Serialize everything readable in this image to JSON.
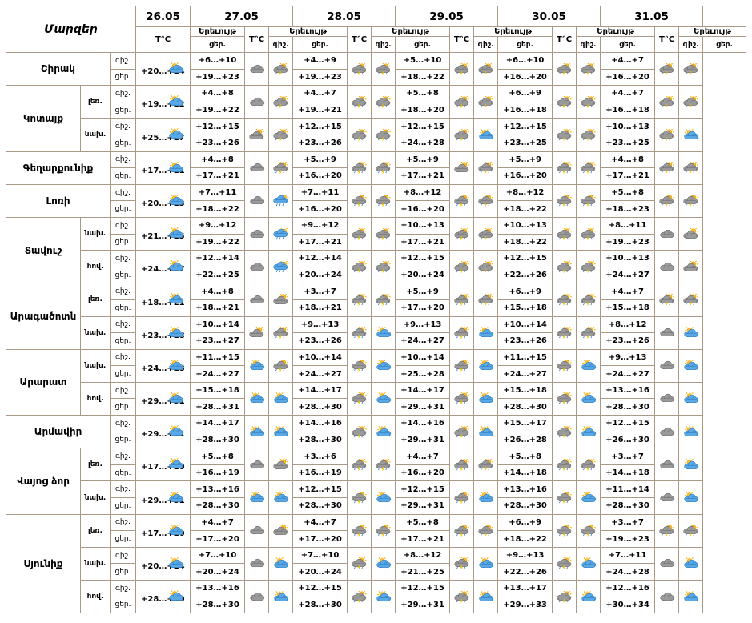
{
  "header": {
    "title": "Մարզեր",
    "dates": [
      "26.05",
      "27.05",
      "28.05",
      "29.05",
      "30.05",
      "31.05"
    ],
    "temp_label": "T°C",
    "phen_label": "Երեւույթ",
    "night_label": "գիշ.",
    "day_label": "ցեր."
  },
  "rows": [
    {
      "region": "Շիրակ",
      "zone": "",
      "tod": "գիշ.",
      "first": "",
      "vals": [
        "+6…+10",
        "+4…+9",
        "+5…+10",
        "+6…+10",
        "+4…+7"
      ],
      "icons": [
        "cloud",
        "storm-sun",
        "storm-sun",
        "storm-sun",
        "storm-sun",
        "storm-sun",
        "storm-sun",
        "storm-sun",
        "storm-sun",
        "storm-sun"
      ]
    },
    {
      "region": "",
      "zone": "",
      "tod": "ցեր.",
      "first": "+20…+24",
      "vals": [
        "+19…+23",
        "+19…+23",
        "+18…+22",
        "+16…+20",
        "+16…+20"
      ],
      "first_icon": "sun-cloud"
    },
    {
      "region": "Կոտայք",
      "zone": "լեռ.",
      "tod": "գիշ.",
      "first": "",
      "vals": [
        "+4…+8",
        "+4…+7",
        "+5…+8",
        "+6…+9",
        "+4…+7"
      ],
      "icons": [
        "cloud",
        "storm-sun",
        "storm-sun",
        "storm-sun",
        "storm-sun",
        "storm-sun",
        "storm-sun",
        "storm-sun",
        "storm-sun",
        "storm-sun"
      ]
    },
    {
      "region": "",
      "zone": "",
      "tod": "ցեր.",
      "first": "+19…+22",
      "vals": [
        "+19…+22",
        "+19…+21",
        "+18…+20",
        "+16…+18",
        "+16…+18"
      ],
      "first_icon": "sun-cloud"
    },
    {
      "region": "",
      "zone": "նախ.",
      "tod": "գիշ.",
      "first": "",
      "vals": [
        "+12…+15",
        "+12…+15",
        "+12…+15",
        "+12…+15",
        "+10…+13"
      ],
      "icons": [
        "cloud-sun",
        "storm-sun",
        "storm-sun",
        "storm-sun",
        "storm-sun",
        "sun-cloud",
        "storm-sun",
        "storm-sun",
        "storm-sun",
        "sun-cloud"
      ]
    },
    {
      "region": "",
      "zone": "",
      "tod": "ցեր.",
      "first": "+25…+27",
      "vals": [
        "+23…+26",
        "+23…+26",
        "+24…+28",
        "+23…+25",
        "+23…+25"
      ],
      "first_icon": "sun-cloud"
    },
    {
      "region": "Գեղարքունիք",
      "zone": "",
      "tod": "գիշ.",
      "first": "",
      "vals": [
        "+4…+8",
        "+5…+9",
        "+5…+9",
        "+5…+9",
        "+4…+8"
      ],
      "icons": [
        "cloud",
        "storm-sun",
        "storm-sun",
        "storm-sun",
        "cloud-sun",
        "storm-sun",
        "storm-sun",
        "storm-sun",
        "storm-sun",
        "storm-sun"
      ]
    },
    {
      "region": "",
      "zone": "",
      "tod": "ցեր.",
      "first": "+17…+21",
      "vals": [
        "+17…+21",
        "+16…+20",
        "+17…+21",
        "+16…+20",
        "+17…+21"
      ],
      "first_icon": "sun-cloud"
    },
    {
      "region": "Լոռի",
      "zone": "",
      "tod": "գիշ.",
      "first": "",
      "vals": [
        "+7…+11",
        "+7…+11",
        "+8…+12",
        "+8…+12",
        "+5…+8"
      ],
      "icons": [
        "cloud",
        "rain",
        "storm-sun",
        "storm-sun",
        "storm-sun",
        "storm-sun",
        "storm-sun",
        "storm-sun",
        "storm-sun",
        "storm-sun"
      ]
    },
    {
      "region": "",
      "zone": "",
      "tod": "ցեր.",
      "first": "+20…+23",
      "vals": [
        "+18…+22",
        "+16…+20",
        "+16…+20",
        "+18…+22",
        "+18…+23"
      ],
      "first_icon": "sun-cloud"
    },
    {
      "region": "Տավուշ",
      "zone": "նախ.",
      "tod": "գիշ.",
      "first": "",
      "vals": [
        "+9…+12",
        "+9…+12",
        "+10…+13",
        "+10…+13",
        "+8…+11"
      ],
      "icons": [
        "cloud",
        "rain",
        "storm-sun",
        "storm-sun",
        "storm-sun",
        "storm-sun",
        "storm-sun",
        "storm-sun",
        "cloud",
        "cloud-sun"
      ]
    },
    {
      "region": "",
      "zone": "",
      "tod": "ցեր.",
      "first": "+21…+25",
      "vals": [
        "+19…+22",
        "+17…+21",
        "+17…+21",
        "+18…+22",
        "+19…+23"
      ],
      "first_icon": "sun-cloud"
    },
    {
      "region": "",
      "zone": "հով.",
      "tod": "գիշ.",
      "first": "",
      "vals": [
        "+12…+14",
        "+12…+14",
        "+12…+15",
        "+12…+15",
        "+10…+13"
      ],
      "icons": [
        "cloud",
        "rain",
        "storm-sun",
        "storm-sun",
        "storm-sun",
        "storm-sun",
        "storm-sun",
        "storm-sun",
        "cloud",
        "cloud-sun"
      ]
    },
    {
      "region": "",
      "zone": "",
      "tod": "ցեր.",
      "first": "+24…+27",
      "vals": [
        "+22…+25",
        "+20…+24",
        "+20…+24",
        "+22…+26",
        "+24…+27"
      ],
      "first_icon": "sun-cloud"
    },
    {
      "region": "Արագածոտն",
      "zone": "լեռ.",
      "tod": "գիշ.",
      "first": "",
      "vals": [
        "+4…+8",
        "+3…+7",
        "+5…+9",
        "+6…+9",
        "+4…+7"
      ],
      "icons": [
        "cloud",
        "cloud-sun",
        "storm-sun",
        "storm-sun",
        "storm-sun",
        "storm-sun",
        "storm-sun",
        "storm-sun",
        "storm-sun",
        "storm-sun"
      ]
    },
    {
      "region": "",
      "zone": "",
      "tod": "ցեր.",
      "first": "+18…+21",
      "vals": [
        "+18…+21",
        "+18…+21",
        "+17…+20",
        "+15…+18",
        "+15…+18"
      ],
      "first_icon": "sun-cloud"
    },
    {
      "region": "",
      "zone": "նախ.",
      "tod": "գիշ.",
      "first": "",
      "vals": [
        "+10…+14",
        "+9…+13",
        "+9…+13",
        "+10…+14",
        "+8…+12"
      ],
      "icons": [
        "cloud-sun",
        "storm-sun",
        "storm-sun",
        "sun-cloud",
        "storm-sun",
        "sun-cloud",
        "storm-sun",
        "storm-sun",
        "cloud",
        "sun-cloud"
      ]
    },
    {
      "region": "",
      "zone": "",
      "tod": "ցեր.",
      "first": "+23…+28",
      "vals": [
        "+23…+27",
        "+23…+26",
        "+24…+27",
        "+23…+26",
        "+23…+26"
      ],
      "first_icon": "sun-cloud"
    },
    {
      "region": "Արարատ",
      "zone": "նախ.",
      "tod": "գիշ.",
      "first": "",
      "vals": [
        "+11…+15",
        "+10…+14",
        "+10…+14",
        "+11…+15",
        "+9…+13"
      ],
      "icons": [
        "sun-cloud",
        "storm-sun",
        "storm-sun",
        "sun-cloud",
        "storm-sun",
        "sun-cloud",
        "storm-sun",
        "sun-cloud",
        "cloud",
        "sun-cloud"
      ]
    },
    {
      "region": "",
      "zone": "",
      "tod": "ցեր.",
      "first": "+24…+28",
      "vals": [
        "+24…+27",
        "+24…+27",
        "+25…+28",
        "+24…+27",
        "+24…+27"
      ],
      "first_icon": "sun-cloud"
    },
    {
      "region": "",
      "zone": "հով.",
      "tod": "գիշ.",
      "first": "",
      "vals": [
        "+15…+18",
        "+14…+17",
        "+14…+17",
        "+15…+18",
        "+13…+16"
      ],
      "icons": [
        "sun-cloud",
        "sun-cloud",
        "storm-sun",
        "sun-cloud",
        "storm-sun",
        "sun-cloud",
        "storm-sun",
        "sun-cloud",
        "cloud",
        "sun-cloud"
      ]
    },
    {
      "region": "",
      "zone": "",
      "tod": "ցեր.",
      "first": "+29…+31",
      "vals": [
        "+28…+31",
        "+28…+30",
        "+29…+31",
        "+28…+30",
        "+28…+30"
      ],
      "first_icon": "sun-cloud"
    },
    {
      "region": "Արմավիր",
      "zone": "",
      "tod": "գիշ.",
      "first": "",
      "vals": [
        "+14…+17",
        "+14…+16",
        "+14…+16",
        "+15…+17",
        "+12…+15"
      ],
      "icons": [
        "sun-cloud",
        "sun-cloud",
        "storm-sun",
        "sun-cloud",
        "storm-sun",
        "sun-cloud",
        "storm-sun",
        "sun-cloud",
        "cloud",
        "sun-cloud"
      ]
    },
    {
      "region": "",
      "zone": "",
      "tod": "ցեր.",
      "first": "+29…+31",
      "vals": [
        "+28…+30",
        "+28…+30",
        "+29…+31",
        "+26…+28",
        "+26…+30"
      ],
      "first_icon": "sun-cloud"
    },
    {
      "region": "Վայոց ձոր",
      "zone": "լեռ.",
      "tod": "գիշ.",
      "first": "",
      "vals": [
        "+5…+8",
        "+3…+6",
        "+4…+7",
        "+5…+8",
        "+3…+7"
      ],
      "icons": [
        "cloud",
        "cloud-sun",
        "storm-sun",
        "storm-sun",
        "storm-sun",
        "storm-sun",
        "storm-sun",
        "storm-sun",
        "cloud",
        "sun-cloud"
      ]
    },
    {
      "region": "",
      "zone": "",
      "tod": "ցեր.",
      "first": "+17…+20",
      "vals": [
        "+16…+19",
        "+16…+19",
        "+16…+20",
        "+14…+18",
        "+14…+18"
      ],
      "first_icon": "sun-cloud"
    },
    {
      "region": "",
      "zone": "նախ.",
      "tod": "գիշ.",
      "first": "",
      "vals": [
        "+13…+16",
        "+12…+15",
        "+12…+15",
        "+13…+16",
        "+11…+14"
      ],
      "icons": [
        "sun-cloud",
        "sun-cloud",
        "storm-sun",
        "sun-cloud",
        "storm-sun",
        "sun-cloud",
        "storm-sun",
        "sun-cloud",
        "cloud",
        "sun-cloud"
      ]
    },
    {
      "region": "",
      "zone": "",
      "tod": "ցեր.",
      "first": "+29…+31",
      "vals": [
        "+28…+30",
        "+28…+30",
        "+29…+31",
        "+28…+30",
        "+28…+30"
      ],
      "first_icon": "sun-cloud"
    },
    {
      "region": "Սյունիք",
      "zone": "լեռ.",
      "tod": "գիշ.",
      "first": "",
      "vals": [
        "+4…+7",
        "+4…+7",
        "+5…+8",
        "+6…+9",
        "+3…+7"
      ],
      "icons": [
        "cloud",
        "cloud-sun",
        "storm-sun",
        "storm-sun",
        "storm-sun",
        "storm-sun",
        "storm-sun",
        "storm-sun",
        "storm-sun",
        "storm-sun"
      ]
    },
    {
      "region": "",
      "zone": "",
      "tod": "ցեր.",
      "first": "+17…+20",
      "vals": [
        "+17…+20",
        "+17…+20",
        "+17…+21",
        "+18…+22",
        "+19…+23"
      ],
      "first_icon": "sun-cloud"
    },
    {
      "region": "",
      "zone": "նախ.",
      "tod": "գիշ.",
      "first": "",
      "vals": [
        "+7…+10",
        "+7…+10",
        "+8…+12",
        "+9…+13",
        "+7…+11"
      ],
      "icons": [
        "cloud",
        "sun-cloud",
        "storm-sun",
        "sun-cloud",
        "storm-sun",
        "sun-cloud",
        "storm-sun",
        "sun-cloud",
        "cloud",
        "sun-cloud"
      ]
    },
    {
      "region": "",
      "zone": "",
      "tod": "ցեր.",
      "first": "+20…+24",
      "vals": [
        "+20…+24",
        "+20…+24",
        "+21…+25",
        "+22…+26",
        "+24…+28"
      ],
      "first_icon": "sun-cloud"
    },
    {
      "region": "",
      "zone": "հով.",
      "tod": "գիշ.",
      "first": "",
      "vals": [
        "+13…+16",
        "+12…+15",
        "+12…+15",
        "+13…+17",
        "+12…+16"
      ],
      "icons": [
        "cloud",
        "sun-cloud",
        "storm-sun",
        "sun-cloud",
        "storm-sun",
        "sun-cloud",
        "storm-sun",
        "sun-cloud",
        "cloud",
        "sun-cloud"
      ]
    },
    {
      "region": "",
      "zone": "",
      "tod": "ցեր.",
      "first": "+28…+30",
      "vals": [
        "+28…+30",
        "+28…+30",
        "+29…+31",
        "+29…+33",
        "+30…+34"
      ],
      "first_icon": "sun-cloud"
    }
  ],
  "layout": {
    "groups": [
      {
        "region_row": 0,
        "span": 2,
        "zoned": false
      },
      {
        "region_row": 2,
        "span": 4,
        "zoned": true
      },
      {
        "region_row": 6,
        "span": 2,
        "zoned": false
      },
      {
        "region_row": 8,
        "span": 2,
        "zoned": false
      },
      {
        "region_row": 10,
        "span": 4,
        "zoned": true
      },
      {
        "region_row": 14,
        "span": 4,
        "zoned": true
      },
      {
        "region_row": 18,
        "span": 4,
        "zoned": true
      },
      {
        "region_row": 22,
        "span": 2,
        "zoned": false
      },
      {
        "region_row": 24,
        "span": 4,
        "zoned": true
      },
      {
        "region_row": 28,
        "span": 6,
        "zoned": true
      }
    ]
  }
}
